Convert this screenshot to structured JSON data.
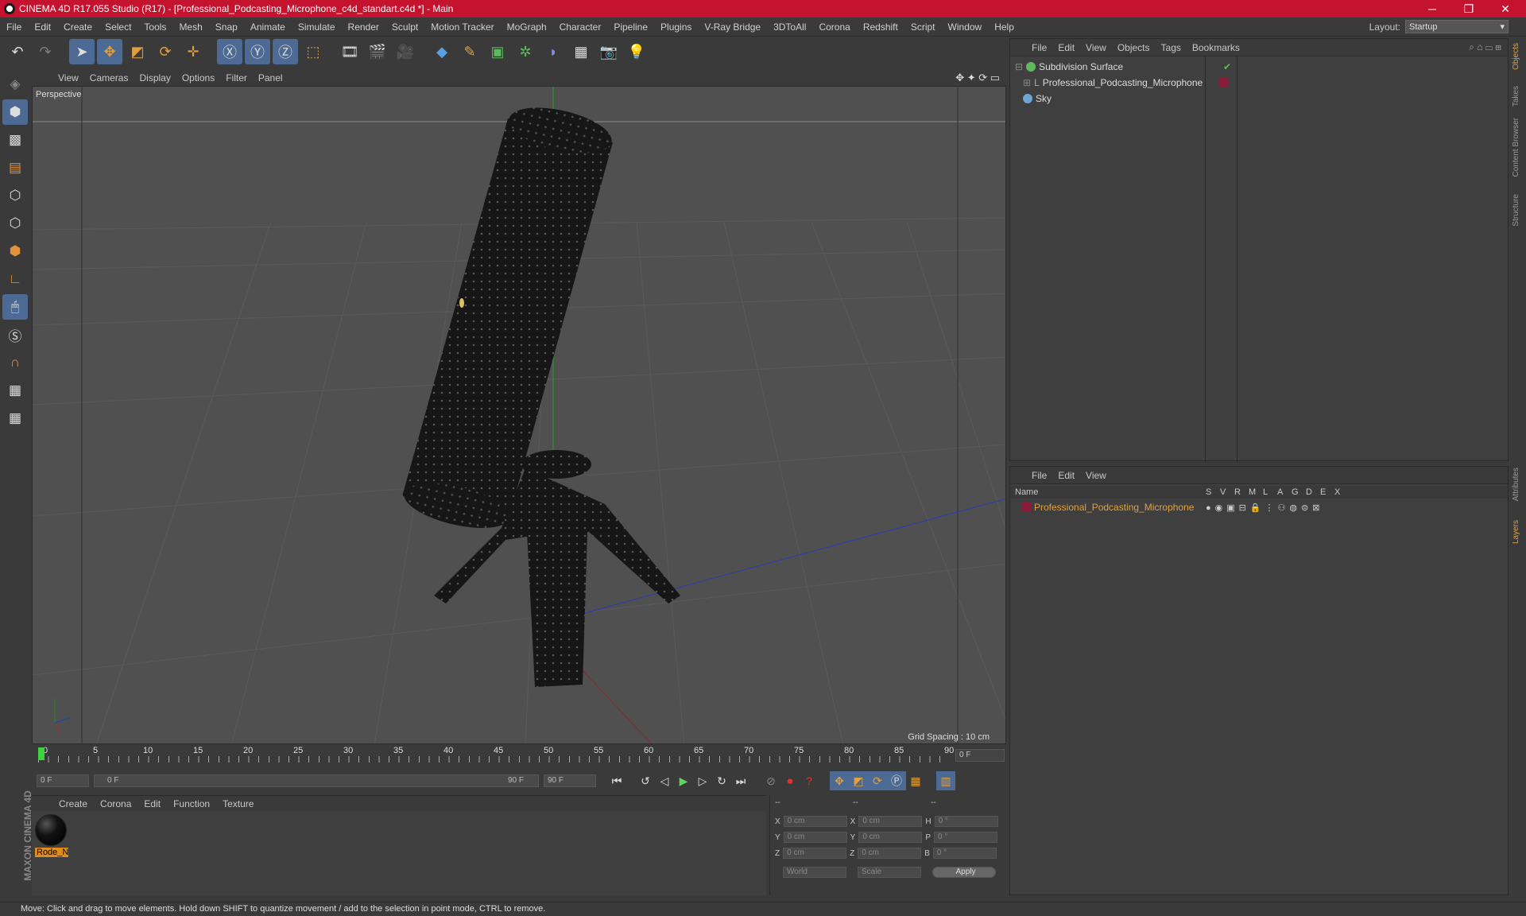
{
  "window": {
    "title": "CINEMA 4D R17.055 Studio (R17) - [Professional_Podcasting_Microphone_c4d_standart.c4d *] - Main",
    "minimize": "─",
    "restore": "❐",
    "close": "✕"
  },
  "menu": [
    "File",
    "Edit",
    "Create",
    "Select",
    "Tools",
    "Mesh",
    "Snap",
    "Animate",
    "Simulate",
    "Render",
    "Sculpt",
    "Motion Tracker",
    "MoGraph",
    "Character",
    "Pipeline",
    "Plugins",
    "V-Ray Bridge",
    "3DToAll",
    "Corona",
    "Redshift",
    "Script",
    "Window",
    "Help"
  ],
  "layout": {
    "label": "Layout:",
    "value": "Startup"
  },
  "viewport": {
    "menu": [
      "View",
      "Cameras",
      "Display",
      "Options",
      "Filter",
      "Panel"
    ],
    "label": "Perspective",
    "grid_spacing": "Grid Spacing : 10 cm"
  },
  "timeline": {
    "ticks": [
      "0",
      "5",
      "10",
      "15",
      "20",
      "25",
      "30",
      "35",
      "40",
      "45",
      "50",
      "55",
      "60",
      "65",
      "70",
      "75",
      "80",
      "85",
      "90"
    ],
    "frame": "0 F"
  },
  "playback": {
    "start": "0 F",
    "range_start": "0 F",
    "range_end": "90 F",
    "end": "90 F"
  },
  "material_panel": {
    "menu": [
      "Create",
      "Corona",
      "Edit",
      "Function",
      "Texture"
    ],
    "material_name": "Rode_N"
  },
  "coords": {
    "headers": [
      "--",
      "--",
      "--"
    ],
    "rows": [
      {
        "a": "X",
        "av": "0 cm",
        "b": "X",
        "bv": "0 cm",
        "c": "H",
        "cv": "0 °"
      },
      {
        "a": "Y",
        "av": "0 cm",
        "b": "Y",
        "bv": "0 cm",
        "c": "P",
        "cv": "0 °"
      },
      {
        "a": "Z",
        "av": "0 cm",
        "b": "Z",
        "bv": "0 cm",
        "c": "B",
        "cv": "0 °"
      }
    ],
    "space": "World",
    "mode": "Scale",
    "apply": "Apply"
  },
  "object_manager": {
    "menu": [
      "File",
      "Edit",
      "View",
      "Objects",
      "Tags",
      "Bookmarks"
    ],
    "objects": [
      {
        "name": "Subdivision Surface",
        "color": "#5dba5d"
      },
      {
        "name": "Professional_Podcasting_Microphone",
        "color": "#aaaaaa"
      },
      {
        "name": "Sky",
        "color": "#6fa6d6"
      }
    ]
  },
  "layer_manager": {
    "menu": [
      "File",
      "Edit",
      "View"
    ],
    "columns": [
      "Name",
      "S",
      "V",
      "R",
      "M",
      "L",
      "A",
      "G",
      "D",
      "E",
      "X"
    ],
    "layer": "Professional_Podcasting_Microphone"
  },
  "side_tabs": [
    "Objects",
    "Takes",
    "Content Browser",
    "Structure",
    "Attributes",
    "Layers"
  ],
  "brand": "MAXON CINEMA 4D",
  "status": "Move: Click and drag to move elements. Hold down SHIFT to quantize movement / add to the selection in point mode, CTRL to remove."
}
